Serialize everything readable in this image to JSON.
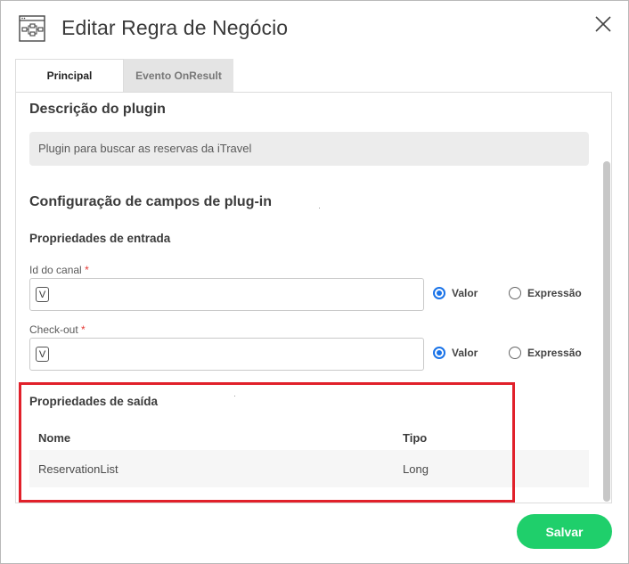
{
  "dialog": {
    "title": "Editar Regra de Negócio",
    "icon": "flowchart-icon",
    "close_icon": "close-icon"
  },
  "tabs": [
    {
      "label": "Principal",
      "active": true
    },
    {
      "label": "Evento OnResult",
      "active": false
    }
  ],
  "description": {
    "heading": "Descrição do plugin",
    "value": "Plugin para buscar as reservas da iTravel"
  },
  "config": {
    "heading": "Configuração de campos de plug-in",
    "input_props_heading": "Propriedades de entrada",
    "fields": [
      {
        "label": "Id do canal",
        "required": "*",
        "badge": "V",
        "value": "",
        "options": [
          "Valor",
          "Expressão"
        ],
        "selected": "Valor"
      },
      {
        "label": "Check-out",
        "required": "*",
        "badge": "V",
        "value": "",
        "options": [
          "Valor",
          "Expressão"
        ],
        "selected": "Valor"
      }
    ]
  },
  "output": {
    "heading": "Propriedades de saída",
    "columns": [
      "Nome",
      "Tipo"
    ],
    "rows": [
      {
        "nome": "ReservationList",
        "tipo": "Long"
      }
    ]
  },
  "footer": {
    "save_label": "Salvar"
  },
  "colors": {
    "primary_radio": "#1a73e8",
    "save_button": "#1fcf6b",
    "highlight_box": "#e1202a",
    "required_mark": "#e53935"
  }
}
